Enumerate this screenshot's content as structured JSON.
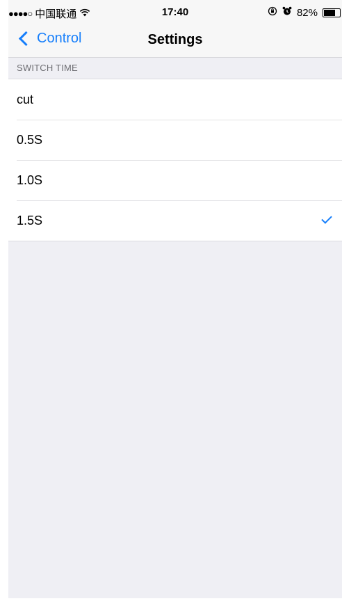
{
  "status_bar": {
    "signal": "●●●●○",
    "carrier": "中国联通",
    "wifi_icon": "wifi-icon",
    "time": "17:40",
    "orientation_lock_icon": "orientation-lock-icon",
    "alarm_icon": "alarm-icon",
    "battery_percent": "82%",
    "battery_level": 0.82
  },
  "nav": {
    "back_label": "Control",
    "title": "Settings"
  },
  "section": {
    "header": "SWITCH TIME",
    "options": [
      {
        "label": "cut",
        "selected": false
      },
      {
        "label": "0.5S",
        "selected": false
      },
      {
        "label": "1.0S",
        "selected": false
      },
      {
        "label": "1.5S",
        "selected": true
      }
    ]
  },
  "colors": {
    "accent": "#157efb",
    "background": "#efeff4",
    "section_header_text": "#6d6d72"
  }
}
